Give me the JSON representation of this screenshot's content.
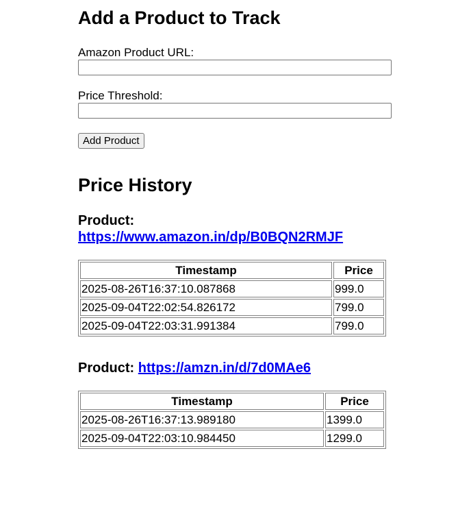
{
  "form": {
    "title": "Add a Product to Track",
    "url_label": "Amazon Product URL:",
    "url_value": "",
    "threshold_label": "Price Threshold:",
    "threshold_value": "",
    "submit_label": "Add Product"
  },
  "history": {
    "title": "Price History",
    "product_prefix": "Product:",
    "products": [
      {
        "url": "https://www.amazon.in/dp/B0BQN2RMJF",
        "columns": [
          "Timestamp",
          "Price"
        ],
        "rows": [
          {
            "timestamp": "2025-08-26T16:37:10.087868",
            "price": "999.0"
          },
          {
            "timestamp": "2025-09-04T22:02:54.826172",
            "price": "799.0"
          },
          {
            "timestamp": "2025-09-04T22:03:31.991384",
            "price": "799.0"
          }
        ]
      },
      {
        "url": "https://amzn.in/d/7d0MAe6",
        "columns": [
          "Timestamp",
          "Price"
        ],
        "rows": [
          {
            "timestamp": "2025-08-26T16:37:13.989180",
            "price": "1399.0"
          },
          {
            "timestamp": "2025-09-04T22:03:10.984450",
            "price": "1299.0"
          }
        ]
      }
    ]
  }
}
